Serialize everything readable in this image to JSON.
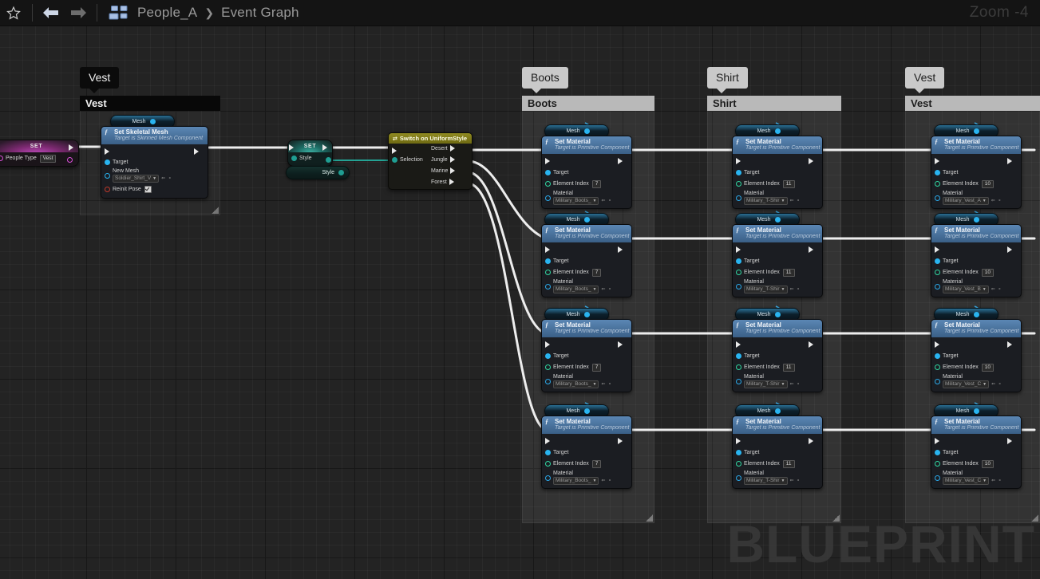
{
  "toolbar": {
    "favorite_icon": "star-icon",
    "back_icon": "back-arrow-icon",
    "forward_icon": "forward-arrow-icon",
    "graph_icon": "blueprint-graph-icon",
    "breadcrumb_root": "People_A",
    "breadcrumb_sep": "❯",
    "breadcrumb_current": "Event Graph",
    "zoom_label": "Zoom -4"
  },
  "canvas": {
    "watermark": "BLUEPRINT",
    "background_hex": "#232323",
    "grid_hex": "#2b2b2b"
  },
  "set_people_type": {
    "title": "SET",
    "pin_label": "People Type",
    "pin_value": "Vest"
  },
  "set_style": {
    "title": "SET",
    "pin_label": "Style",
    "getter_label": "Style"
  },
  "switch_node": {
    "title": "Switch on UniformStyle",
    "input_exec": "exec-in",
    "selection_label": "Selection",
    "outputs": [
      "Desert",
      "Jungle",
      "Marine",
      "Forest"
    ]
  },
  "comments": [
    {
      "id": "vest-left",
      "bubble": "Vest",
      "title": "Vest",
      "style": "dark"
    },
    {
      "id": "boots",
      "bubble": "Boots",
      "title": "Boots",
      "style": "light"
    },
    {
      "id": "shirt",
      "bubble": "Shirt",
      "title": "Shirt",
      "style": "light"
    },
    {
      "id": "vest-right",
      "bubble": "Vest",
      "title": "Vest",
      "style": "light"
    }
  ],
  "skeletal_node": {
    "mesh_pill": "Mesh",
    "title": "Set Skeletal Mesh",
    "subtitle": "Target is Skinned Mesh Component",
    "target_label": "Target",
    "newmesh_label": "New Mesh",
    "newmesh_value": "Soldier_Shirt_V",
    "reinit_label": "Reinit Pose",
    "reinit_checked": true,
    "mini_icons": "⇐ ∘"
  },
  "material_node_common": {
    "mesh_pill": "Mesh",
    "title": "Set Material",
    "subtitle": "Target is Primitive Component",
    "target_label": "Target",
    "element_label": "Element Index",
    "material_label": "Material",
    "mini_icons": "⇐ ∘"
  },
  "columns": [
    {
      "name": "Boots",
      "nodes": [
        {
          "element_index": "7",
          "material": "Military_Boots_"
        },
        {
          "element_index": "7",
          "material": "Military_Boots_"
        },
        {
          "element_index": "7",
          "material": "Military_Boots_"
        },
        {
          "element_index": "7",
          "material": "Military_Boots_"
        }
      ]
    },
    {
      "name": "Shirt",
      "nodes": [
        {
          "element_index": "11",
          "material": "Military_T-Shir"
        },
        {
          "element_index": "11",
          "material": "Military_T-Shir"
        },
        {
          "element_index": "11",
          "material": "Military_T-Shir"
        },
        {
          "element_index": "11",
          "material": "Military_T-Shir"
        }
      ]
    },
    {
      "name": "Vest",
      "nodes": [
        {
          "element_index": "10",
          "material": "Military_Vest_A"
        },
        {
          "element_index": "10",
          "material": "Military_Vest_B"
        },
        {
          "element_index": "10",
          "material": "Military_Vest_C"
        },
        {
          "element_index": "10",
          "material": "Military_Vest_C"
        }
      ]
    }
  ]
}
